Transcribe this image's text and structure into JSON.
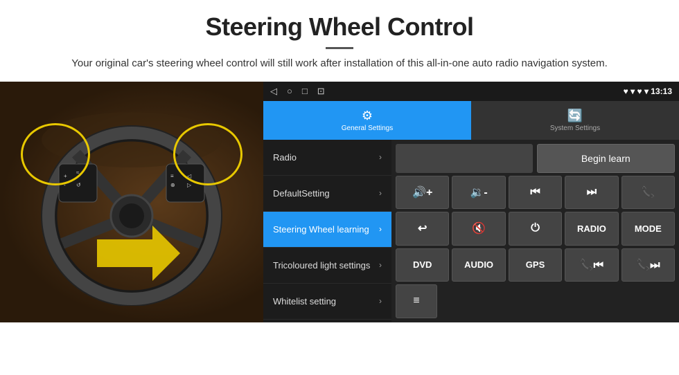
{
  "header": {
    "title": "Steering Wheel Control",
    "subtitle": "Your original car's steering wheel control will still work after installation of this all-in-one auto radio navigation system.",
    "divider": true
  },
  "statusBar": {
    "icons": [
      "◁",
      "○",
      "□",
      "⊡"
    ],
    "rightText": "♥ ▾ 13:13"
  },
  "tabs": [
    {
      "id": "general",
      "label": "General Settings",
      "icon": "⚙",
      "active": true
    },
    {
      "id": "system",
      "label": "System Settings",
      "icon": "🔄",
      "active": false
    }
  ],
  "menuItems": [
    {
      "label": "Radio",
      "active": false,
      "arrow": "›"
    },
    {
      "label": "DefaultSetting",
      "active": false,
      "arrow": "›"
    },
    {
      "label": "Steering Wheel learning",
      "active": true,
      "arrow": "›"
    },
    {
      "label": "Tricoloured light settings",
      "active": false,
      "arrow": "›"
    },
    {
      "label": "Whitelist setting",
      "active": false,
      "arrow": "›"
    }
  ],
  "controls": {
    "beginLearnLabel": "Begin learn",
    "buttons": [
      [
        {
          "label": "🔊+",
          "type": "icon"
        },
        {
          "label": "🔉-",
          "type": "icon"
        },
        {
          "label": "⏮",
          "type": "icon"
        },
        {
          "label": "⏭",
          "type": "icon"
        },
        {
          "label": "📞",
          "type": "icon"
        }
      ],
      [
        {
          "label": "↩",
          "type": "icon"
        },
        {
          "label": "🔇",
          "type": "icon"
        },
        {
          "label": "⏻",
          "type": "icon"
        },
        {
          "label": "RADIO",
          "type": "text"
        },
        {
          "label": "MODE",
          "type": "text"
        }
      ],
      [
        {
          "label": "DVD",
          "type": "text"
        },
        {
          "label": "AUDIO",
          "type": "text"
        },
        {
          "label": "GPS",
          "type": "text"
        },
        {
          "label": "📞⏮",
          "type": "icon"
        },
        {
          "label": "📞⏭",
          "type": "icon"
        }
      ],
      [
        {
          "label": "≡",
          "type": "icon"
        }
      ]
    ]
  }
}
